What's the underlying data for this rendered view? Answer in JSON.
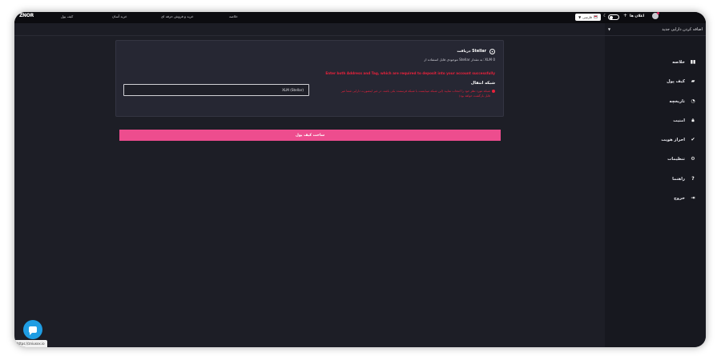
{
  "topbar": {
    "logo": "ZNOR",
    "nav": [
      "کیف پول",
      "خرید آسان",
      "خرید و فروش حرفه ای",
      "خلاصه"
    ],
    "language": "فارسی",
    "notifications_label": "اعلان ها",
    "plus": "+"
  },
  "sidebar": {
    "add_asset": "اضافه کردن دارایی جدید",
    "items": [
      {
        "label": "خلاصه",
        "icon": "bar-chart-icon"
      },
      {
        "label": "کیف پول",
        "icon": "wallet-icon"
      },
      {
        "label": "تاریخچه",
        "icon": "history-icon"
      },
      {
        "label": "امنیت",
        "icon": "lock-icon"
      },
      {
        "label": "احراز هویت",
        "icon": "verified-icon"
      },
      {
        "label": "تنظیمات",
        "icon": "gear-icon"
      },
      {
        "label": "راهنما",
        "icon": "help-icon"
      },
      {
        "label": "خروج",
        "icon": "logout-icon"
      }
    ]
  },
  "card": {
    "title": "دریافت Stellar",
    "balance": "موجودی قابل استفاده از Stellar به مقدار: XLM 0",
    "warning": "Enter both Address and Tag, which are required to deposit into your account successfully",
    "network_title": "شبکه انتقال",
    "network_value": "XLM (Stellar)",
    "network_warning": "شبکه مورد نظر خود را انتخاب نمایید (این شبکه میبایست با شبکه فرستنده یکی باشد، در غیر اینصورت دارایی شما غیر قابل بازگشت خواهد بود)"
  },
  "create_button": "ساخت کیف پول",
  "status_url": "https://zniuxxx.io",
  "colors": {
    "accent": "#ed4d8e",
    "warning": "#e8213b",
    "chat": "#1f9de3"
  }
}
